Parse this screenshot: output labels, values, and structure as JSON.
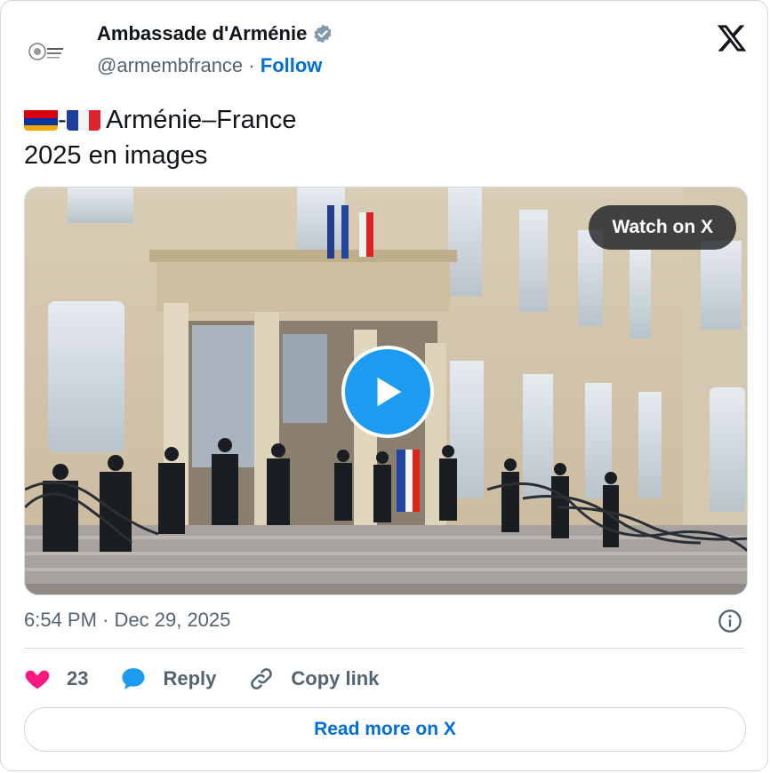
{
  "author": {
    "name": "Ambassade d'Arménie",
    "handle": "@armembfrance",
    "separator": "·",
    "follow_label": "Follow",
    "verified": true
  },
  "tweet": {
    "line1": "Arménie–France",
    "line2": "2025 en images",
    "flag_separator": "-",
    "flags": [
      "armenia-flag-icon",
      "france-flag-icon"
    ]
  },
  "media": {
    "watch_label": "Watch on X",
    "play_icon": "play-icon",
    "description_colors": {
      "accent": "#1d9bf0"
    }
  },
  "meta": {
    "time": "6:54 PM",
    "separator": "·",
    "date": "Dec 29, 2025",
    "info_icon": "info-icon"
  },
  "actions": {
    "likes_count": "23",
    "reply_label": "Reply",
    "copy_label": "Copy link"
  },
  "footer": {
    "read_more_label": "Read more on X"
  },
  "colors": {
    "link": "#006fd6",
    "like": "#f91880",
    "reply": "#1d9bf0",
    "muted": "#536471",
    "border": "#cfd9de"
  }
}
